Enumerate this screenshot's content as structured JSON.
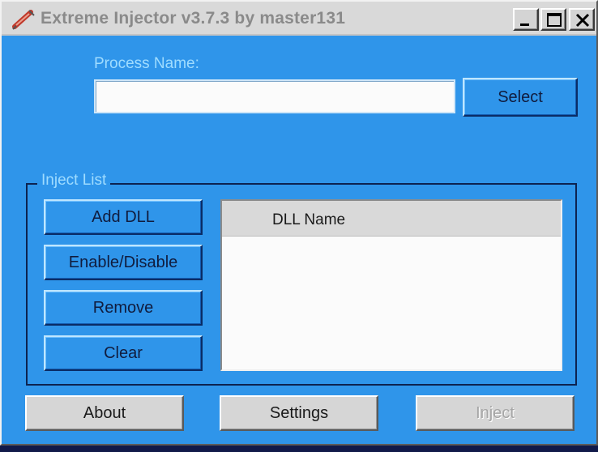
{
  "window": {
    "title": "Extreme Injector v3.7.3 by master131"
  },
  "process": {
    "label": "Process Name:",
    "input_value": "",
    "input_placeholder": "",
    "select_label": "Select"
  },
  "inject_list": {
    "group_label": "Inject List",
    "buttons": {
      "add_dll": "Add DLL",
      "enable_disable": "Enable/Disable",
      "remove": "Remove",
      "clear": "Clear"
    },
    "columns": [
      "DLL Name"
    ],
    "rows": []
  },
  "footer": {
    "about": "About",
    "settings": "Settings",
    "inject": "Inject"
  },
  "colors": {
    "window_background": "#2f95ea",
    "title_bar": "#d9d9d9",
    "label_text": "#9fdcff",
    "disabled_text": "#a6a6a6"
  },
  "icons": {
    "app": "syringe-icon",
    "minimize": "minimize-icon",
    "maximize": "maximize-icon",
    "close": "close-icon"
  }
}
